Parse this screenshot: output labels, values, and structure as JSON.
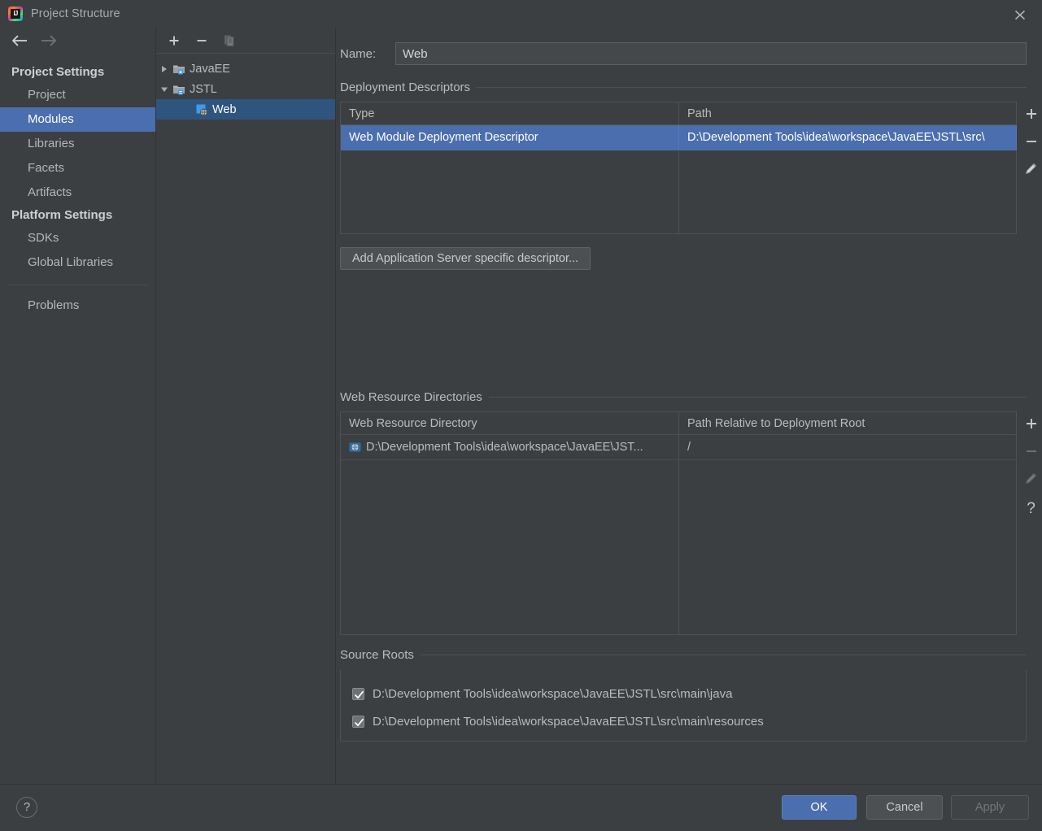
{
  "window": {
    "title": "Project Structure",
    "logo_icon": "intellij-idea-logo",
    "logo_text": "IJ",
    "close_icon": "close-icon"
  },
  "nav": {
    "back_icon": "arrow-left-icon",
    "forward_icon": "arrow-right-icon"
  },
  "sidebar": {
    "groups": [
      {
        "label": "Project Settings",
        "items": [
          {
            "label": "Project",
            "selected": false
          },
          {
            "label": "Modules",
            "selected": true
          },
          {
            "label": "Libraries",
            "selected": false
          },
          {
            "label": "Facets",
            "selected": false
          },
          {
            "label": "Artifacts",
            "selected": false
          }
        ]
      },
      {
        "label": "Platform Settings",
        "items": [
          {
            "label": "SDKs",
            "selected": false
          },
          {
            "label": "Global Libraries",
            "selected": false
          }
        ]
      }
    ],
    "footer_items": [
      {
        "label": "Problems",
        "selected": false
      }
    ]
  },
  "tree_toolbar": {
    "add_icon": "plus-icon",
    "remove_icon": "minus-icon",
    "copy_icon": "copy-icon"
  },
  "tree": {
    "nodes": [
      {
        "label": "JavaEE",
        "icon": "module-icon",
        "twisty": "chevron-right-icon",
        "depth": 0,
        "selected": false
      },
      {
        "label": "JSTL",
        "icon": "module-icon",
        "twisty": "chevron-down-icon",
        "depth": 0,
        "selected": false
      },
      {
        "label": "Web",
        "icon": "web-facet-icon",
        "twisty": "none",
        "depth": 1,
        "selected": true
      }
    ]
  },
  "main": {
    "name": {
      "label": "Name:",
      "value": "Web",
      "placeholder": ""
    },
    "deployment_descriptors": {
      "title": "Deployment Descriptors",
      "columns": [
        "Type",
        "Path"
      ],
      "rows": [
        {
          "type": "Web Module Deployment Descriptor",
          "path": "D:\\Development Tools\\idea\\workspace\\JavaEE\\JSTL\\src\\",
          "selected": true
        }
      ],
      "actions": [
        {
          "icon": "plus-icon",
          "name": "add-descriptor-button",
          "enabled": true
        },
        {
          "icon": "minus-icon",
          "name": "remove-descriptor-button",
          "enabled": true
        },
        {
          "icon": "pencil-icon",
          "name": "edit-descriptor-button",
          "enabled": true
        }
      ],
      "add_server_descriptor_button": "Add Application Server specific descriptor..."
    },
    "web_resource_directories": {
      "title": "Web Resource Directories",
      "columns": [
        "Web Resource Directory",
        "Path Relative to Deployment Root"
      ],
      "rows": [
        {
          "directory": "D:\\Development Tools\\idea\\workspace\\JavaEE\\JST...",
          "directory_icon": "folder-web-icon",
          "relative_path": "/",
          "selected": false
        }
      ],
      "actions": [
        {
          "icon": "plus-icon",
          "name": "add-web-resource-button",
          "enabled": true
        },
        {
          "icon": "minus-icon",
          "name": "remove-web-resource-button",
          "enabled": false
        },
        {
          "icon": "pencil-icon",
          "name": "edit-web-resource-button",
          "enabled": false
        },
        {
          "icon": "question-icon",
          "name": "web-resource-help-button",
          "enabled": true
        }
      ]
    },
    "source_roots": {
      "title": "Source Roots",
      "items": [
        {
          "label": "D:\\Development Tools\\idea\\workspace\\JavaEE\\JSTL\\src\\main\\java",
          "checked": true
        },
        {
          "label": "D:\\Development Tools\\idea\\workspace\\JavaEE\\JSTL\\src\\main\\resources",
          "checked": true
        }
      ]
    }
  },
  "footer": {
    "help_icon": "question-icon",
    "help_label": "?",
    "ok_label": "OK",
    "cancel_label": "Cancel",
    "apply_label": "Apply",
    "apply_enabled": false
  },
  "colors": {
    "background": "#3C3F41",
    "accent_selection": "#4B6EAF",
    "tree_selection": "#2F557F",
    "text": "#BBBBBB",
    "border": "#4E5052"
  }
}
